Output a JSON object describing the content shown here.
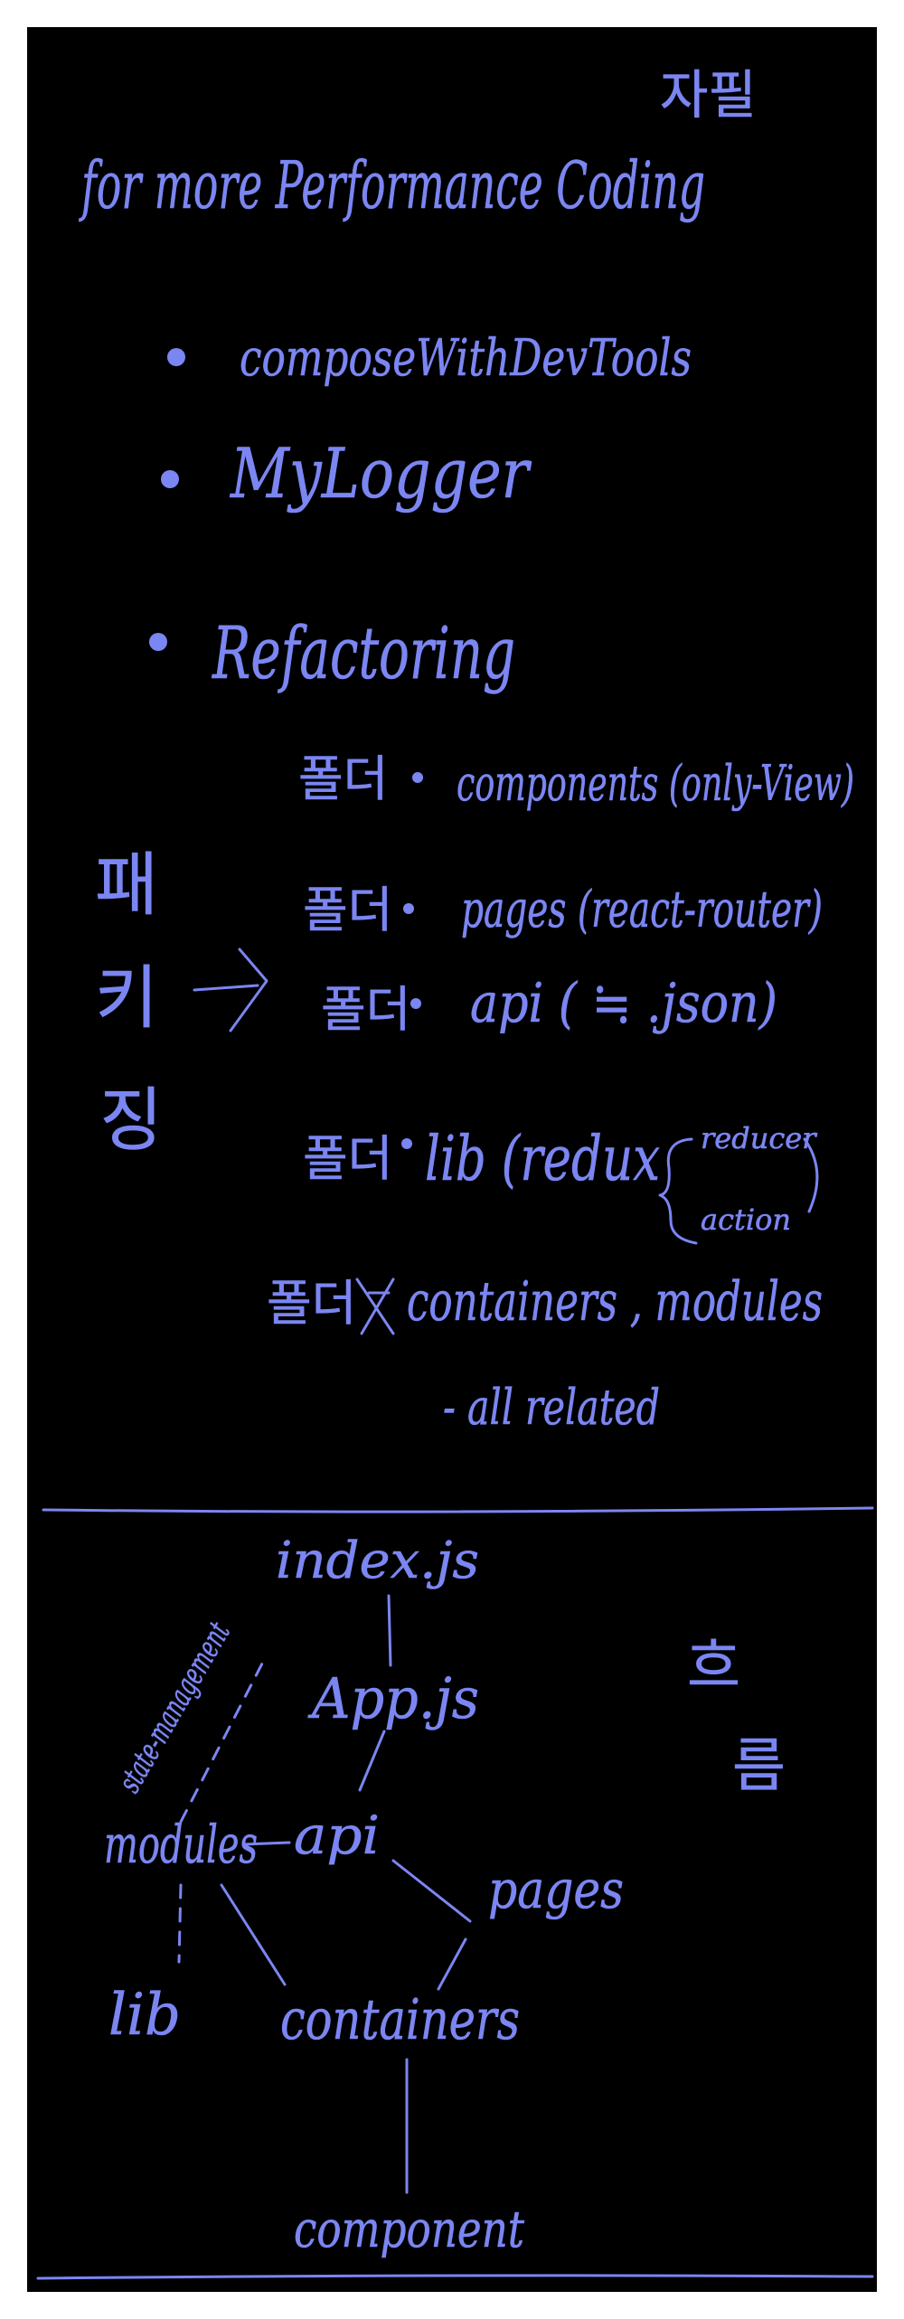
{
  "colors": {
    "background": "#000000",
    "ink": "#7b86f2",
    "frame": "#ffffff"
  },
  "notes": {
    "corner_tag": "자필",
    "title": "for more Performance Coding",
    "bullets": [
      "composeWithDevTools",
      "MyLogger",
      "Refactoring"
    ],
    "side_label_lines": [
      "패",
      "키",
      "징"
    ],
    "arrow": "→",
    "folder_word": "폴더",
    "folders": [
      "components (only-View)",
      "pages (react-router)",
      "api ( ≒ .json)",
      "lib (redux",
      "containers , modules"
    ],
    "lib_sub": [
      "reducer",
      "action"
    ],
    "folder_note": "- all related"
  },
  "flow": {
    "label_lines": [
      "흐",
      "름"
    ],
    "nodes": {
      "index": "index.js",
      "app": "App.js",
      "modules": "modules",
      "api": "api",
      "pages": "pages",
      "lib": "lib",
      "containers": "containers",
      "component": "component"
    },
    "edge_label": "state-management"
  }
}
